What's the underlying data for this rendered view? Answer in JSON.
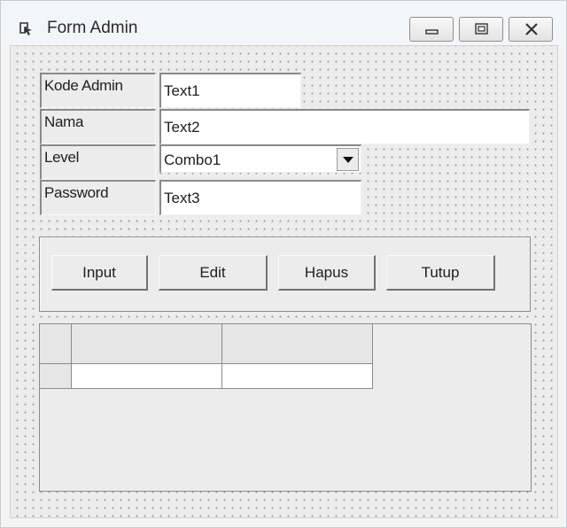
{
  "window": {
    "title": "Form Admin",
    "icon": "form-icon",
    "controls": [
      "minimize-icon",
      "maximize-icon",
      "close-icon"
    ]
  },
  "fields": {
    "kode_admin": {
      "label": "Kode Admin",
      "value": "Text1"
    },
    "nama": {
      "label": "Nama",
      "value": "Text2"
    },
    "level": {
      "label": "Level",
      "value": "Combo1",
      "arrow_icon": "chevron-down-icon"
    },
    "password": {
      "label": "Password",
      "value": "Text3"
    }
  },
  "buttons": {
    "input": "Input",
    "edit": "Edit",
    "hapus": "Hapus",
    "tutup": "Tutup"
  },
  "grid": {
    "columns": 2,
    "rows": 1
  }
}
